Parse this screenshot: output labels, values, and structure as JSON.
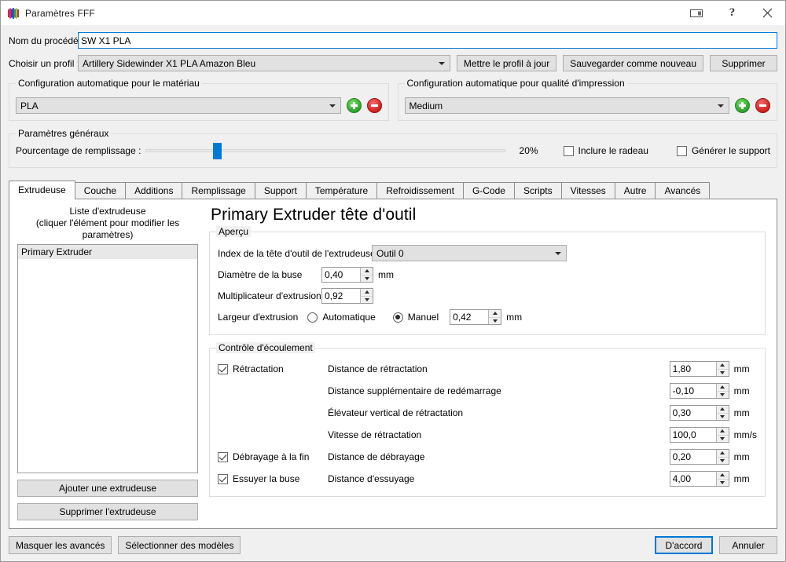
{
  "window": {
    "title": "Paramètres FFF",
    "app_icon": "simplify3d-logo-icon",
    "buttons": {
      "restore": "restore-window-icon",
      "help": "?",
      "close": "×"
    }
  },
  "top": {
    "process_name_label": "Nom du procédé :",
    "process_name_value": "SW X1 PLA",
    "process_name_placeholder": "Nom du procédé",
    "profile_label": "Choisir un profil :",
    "profile_value": "Artillery Sidewinder X1 PLA Amazon Bleu",
    "update_profile_button": "Mettre le profil à jour",
    "save_as_new_button": "Sauvegarder comme nouveau",
    "delete_button": "Supprimer"
  },
  "material_group": {
    "title": "Configuration automatique pour le matériau",
    "value": "PLA",
    "add_icon": "add-circle-icon",
    "remove_icon": "remove-circle-icon"
  },
  "quality_group": {
    "title": "Configuration automatique pour qualité d'impression",
    "value": "Medium",
    "add_icon": "add-circle-icon",
    "remove_icon": "remove-circle-icon"
  },
  "general_group": {
    "title": "Paramètres généraux",
    "infill_label": "Pourcentage de remplissage :",
    "infill_value": "20%",
    "infill_percent": 20,
    "raft_label": "Inclure le radeau",
    "raft_checked": false,
    "support_label": "Générer le support",
    "support_checked": false
  },
  "tabs": [
    {
      "label": "Extrudeuse",
      "active": true
    },
    {
      "label": "Couche",
      "active": false
    },
    {
      "label": "Additions",
      "active": false
    },
    {
      "label": "Remplissage",
      "active": false
    },
    {
      "label": "Support",
      "active": false
    },
    {
      "label": "Température",
      "active": false
    },
    {
      "label": "Refroidissement",
      "active": false
    },
    {
      "label": "G-Code",
      "active": false
    },
    {
      "label": "Scripts",
      "active": false
    },
    {
      "label": "Vitesses",
      "active": false
    },
    {
      "label": "Autre",
      "active": false
    },
    {
      "label": "Avancés",
      "active": false
    }
  ],
  "extruder_list": {
    "caption_line1": "Liste d'extrudeuse",
    "caption_line2": "(cliquer l'élément pour modifier les paramètres)",
    "items": [
      "Primary Extruder"
    ],
    "add_button": "Ajouter une extrudeuse",
    "remove_button": "Supprimer l'extrudeuse"
  },
  "extruder_panel": {
    "title": "Primary Extruder tête d'outil",
    "overview": {
      "title": "Aperçu",
      "toolhead_index_label": "Index de la tête d'outil de l'extrudeuse",
      "toolhead_index_value": "Outil 0",
      "nozzle_diameter_label": "Diamètre de la buse",
      "nozzle_diameter_value": "0,40",
      "nozzle_diameter_unit": "mm",
      "extrusion_multiplier_label": "Multiplicateur d'extrusion",
      "extrusion_multiplier_value": "0,92",
      "extrusion_width_label": "Largeur d'extrusion",
      "extrusion_width_auto_label": "Automatique",
      "extrusion_width_manual_label": "Manuel",
      "extrusion_width_mode": "manual",
      "extrusion_width_value": "0,42",
      "extrusion_width_unit": "mm"
    },
    "flow_control": {
      "title": "Contrôle d'écoulement",
      "retraction_checkbox": "Rétractation",
      "retraction_checked": true,
      "coast_checkbox": "Débrayage à la fin",
      "coast_checked": true,
      "wipe_checkbox": "Essuyer la buse",
      "wipe_checked": true,
      "fields": [
        {
          "label": "Distance de rétractation",
          "value": "1,80",
          "unit": "mm"
        },
        {
          "label": "Distance supplémentaire de redémarrage",
          "value": "-0,10",
          "unit": "mm"
        },
        {
          "label": "Élévateur vertical de rétractation",
          "value": "0,30",
          "unit": "mm"
        },
        {
          "label": "Vitesse de rétractation",
          "value": "100,0",
          "unit": "mm/s"
        },
        {
          "label": "Distance de débrayage",
          "value": "0,20",
          "unit": "mm"
        },
        {
          "label": "Distance d'essuyage",
          "value": "4,00",
          "unit": "mm"
        }
      ]
    }
  },
  "footer": {
    "hide_advanced_button": "Masquer les avancés",
    "select_models_button": "Sélectionner des modèles",
    "ok_button": "D'accord",
    "cancel_button": "Annuler"
  },
  "colors": {
    "accent": "#0078d7",
    "slider": "#007ad9",
    "add": "#2ea32c",
    "remove": "#d31f1f"
  }
}
